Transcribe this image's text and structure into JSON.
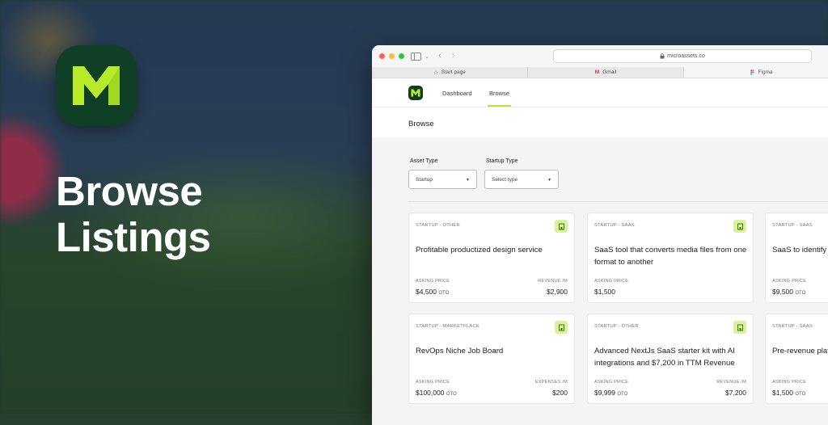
{
  "hero": {
    "headline_line1": "Browse",
    "headline_line2": "Listings",
    "logo_letter": "M"
  },
  "browser": {
    "url": "microassets.co",
    "tabs": [
      {
        "label": "Start page",
        "icon": "star-icon"
      },
      {
        "label": "Gmail",
        "icon": "gmail-icon"
      },
      {
        "label": "Figma",
        "icon": "figma-icon"
      }
    ]
  },
  "nav": {
    "logo_letter": "M",
    "links": [
      "Dashboard",
      "Browse"
    ],
    "active": "Browse"
  },
  "page": {
    "title": "Browse"
  },
  "filters": {
    "asset_type": {
      "label": "Asset Type",
      "value": "Startup"
    },
    "startup_type": {
      "label": "Startup Type",
      "placeholder": "Select type"
    }
  },
  "listings": [
    {
      "category": "STARTUP - OTHER",
      "title": "Profitable productized design service",
      "left_label": "ASKING PRICE",
      "left_value": "$4,500",
      "left_suffix": "OTO",
      "right_label": "REVENUE /M",
      "right_value": "$2,900"
    },
    {
      "category": "STARTUP - SAAS",
      "title": "SaaS tool that converts media files from one format to another",
      "left_label": "ASKING PRICE",
      "left_value": "$1,500",
      "left_suffix": "",
      "right_label": "",
      "right_value": ""
    },
    {
      "category": "STARTUP - SAAS",
      "title": "SaaS to identify opportunities in",
      "left_label": "ASKING PRICE",
      "left_value": "$9,500",
      "left_suffix": "OTO",
      "right_label": "",
      "right_value": ""
    },
    {
      "category": "STARTUP - MARKETPLACE",
      "title": "RevOps Niche Job Board",
      "left_label": "ASKING PRICE",
      "left_value": "$100,000",
      "left_suffix": "OTO",
      "right_label": "EXPENSES /M",
      "right_value": "$200"
    },
    {
      "category": "STARTUP - OTHER",
      "title": "Advanced NextJs SaaS starter kit with AI integrations and $7,200 in TTM Revenue",
      "left_label": "ASKING PRICE",
      "left_value": "$9,999",
      "left_suffix": "OTO",
      "right_label": "REVENUE /M",
      "right_value": "$7,200"
    },
    {
      "category": "STARTUP - SAAS",
      "title": "Pre-revenue platform content with AI",
      "left_label": "ASKING PRICE",
      "left_value": "$1,500",
      "left_suffix": "OTO",
      "right_label": "",
      "right_value": ""
    }
  ],
  "colors": {
    "brand_dark_green": "#0f3f24",
    "brand_lime": "#b6ea2a",
    "badge_bg": "#d8f39a"
  }
}
